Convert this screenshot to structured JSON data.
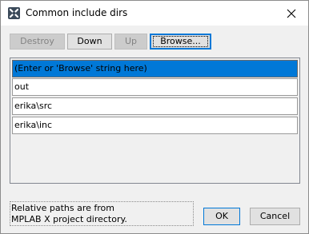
{
  "window": {
    "title": "Common include dirs",
    "app_icon": "app-logo-icon",
    "close_icon": "close-icon"
  },
  "toolbar": {
    "destroy_label": "Destroy",
    "down_label": "Down",
    "up_label": "Up",
    "browse_label": "Browse..."
  },
  "list": {
    "items": [
      "(Enter or 'Browse' string here)",
      "out",
      "erika\\src",
      "erika\\inc"
    ],
    "selected_index": 0,
    "selected_color": "#0078d7"
  },
  "info": {
    "line1": "Relative paths are from",
    "line2": "MPLAB X project directory."
  },
  "buttons": {
    "ok_label": "OK",
    "cancel_label": "Cancel"
  }
}
